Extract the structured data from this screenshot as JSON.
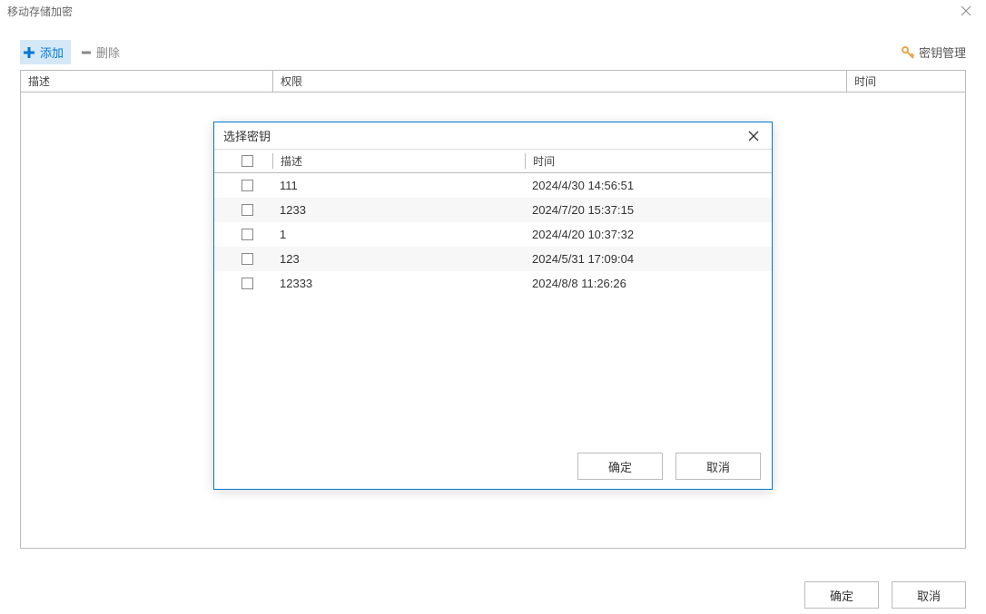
{
  "window": {
    "title": "移动存储加密"
  },
  "toolbar": {
    "add_label": "添加",
    "delete_label": "删除",
    "keymgr_label": "密钥管理"
  },
  "main_table": {
    "headers": {
      "description": "描述",
      "permission": "权限",
      "time": "时间"
    }
  },
  "buttons": {
    "ok": "确定",
    "cancel": "取消"
  },
  "dialog": {
    "title": "选择密钥",
    "headers": {
      "description": "描述",
      "time": "时间"
    },
    "rows": [
      {
        "description": "111",
        "time": "2024/4/30 14:56:51"
      },
      {
        "description": "1233",
        "time": "2024/7/20 15:37:15"
      },
      {
        "description": "1",
        "time": "2024/4/20 10:37:32"
      },
      {
        "description": "123",
        "time": "2024/5/31 17:09:04"
      },
      {
        "description": "12333",
        "time": "2024/8/8 11:26:26"
      }
    ],
    "ok": "确定",
    "cancel": "取消"
  }
}
